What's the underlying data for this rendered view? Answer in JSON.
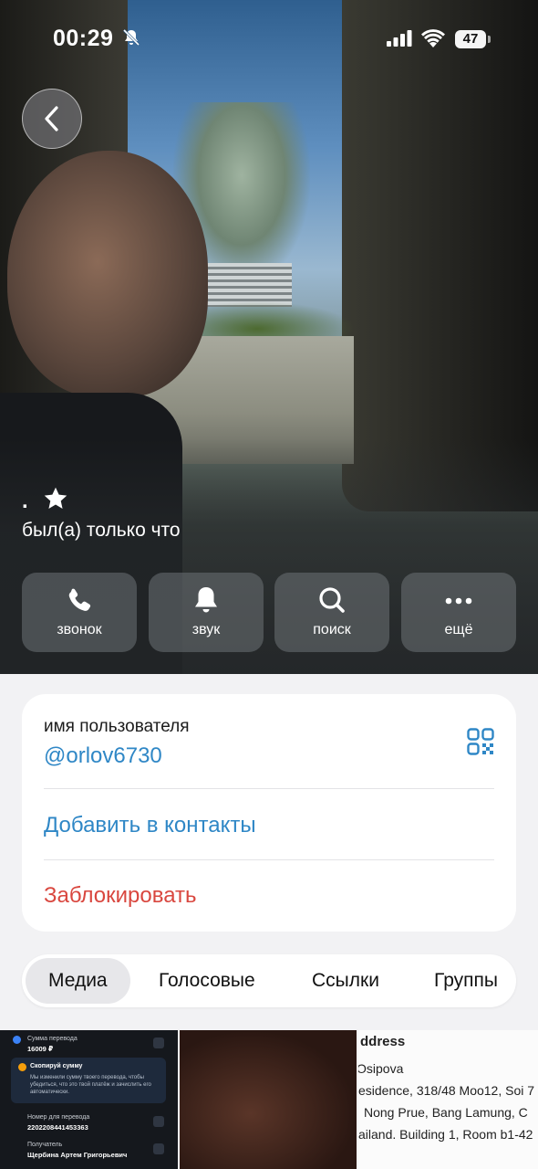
{
  "status_bar": {
    "time": "00:29",
    "battery": "47",
    "icons": [
      "bell-slash-icon",
      "signal-icon",
      "wifi-icon",
      "battery-icon"
    ]
  },
  "header": {
    "back_icon": "chevron-left-icon",
    "name": ".",
    "name_badge_icon": "star-icon",
    "last_seen": "был(а) только что"
  },
  "actions": [
    {
      "label": "звонок",
      "icon": "phone-icon"
    },
    {
      "label": "звук",
      "icon": "bell-icon"
    },
    {
      "label": "поиск",
      "icon": "search-icon"
    },
    {
      "label": "ещё",
      "icon": "more-icon"
    }
  ],
  "info": {
    "username_label": "имя пользователя",
    "username": "@orlov6730",
    "qr_icon": "qr-code-icon",
    "add_contact": "Добавить в контакты",
    "block": "Заблокировать"
  },
  "tabs": [
    {
      "label": "Медиа",
      "active": true
    },
    {
      "label": "Голосовые",
      "active": false
    },
    {
      "label": "Ссылки",
      "active": false
    },
    {
      "label": "Группы",
      "active": false
    }
  ],
  "media": {
    "thumb1": {
      "amount_label": "Сумма перевода",
      "amount": "16009 ₽",
      "copy_title": "Скопируй сумму",
      "copy_text": "Мы изменили сумму твоего перевода, чтобы убедиться, что это твой платёж и зачислить его автоматически.",
      "number_label": "Номер для перевода",
      "number": "2202208441453363",
      "recipient_label": "Получатель",
      "recipient": "Щербина Артем Григорьевич"
    },
    "thumb3": {
      "line1": "ddress",
      "line2": "Osipova",
      "line3": "esidence, 318/48 Moo12, Soi 7",
      "line4": "Nong Prue, Bang Lamung, C",
      "line5": "ailand. Building 1, Room b1-42"
    }
  },
  "colors": {
    "accent": "#2f87c6",
    "destructive": "#d9473f",
    "background": "#f2f2f4"
  }
}
